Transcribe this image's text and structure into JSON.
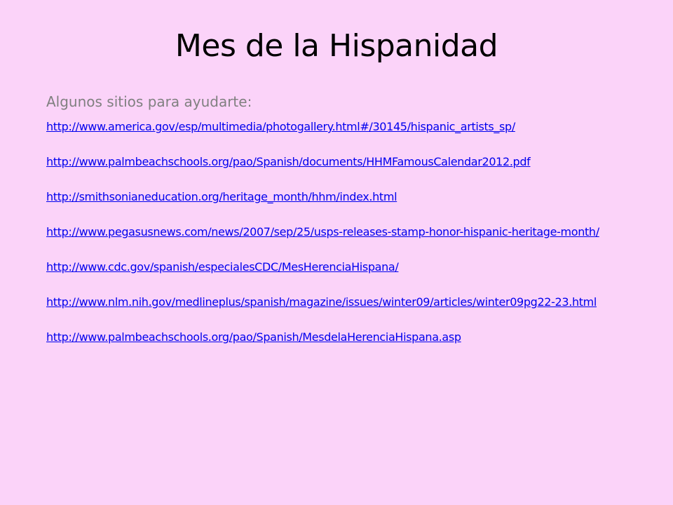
{
  "slide": {
    "title": "Mes de la Hispanidad",
    "subtitle": "Algunos sitios para ayudarte:",
    "links": [
      "http://www.america.gov/esp/multimedia/photogallery.html#/30145/hispanic_artists_sp/",
      "http://www.palmbeachschools.org/pao/Spanish/documents/HHMFamousCalendar2012.pdf",
      "http://smithsonianeducation.org/heritage_month/hhm/index.html",
      "http://www.pegasusnews.com/news/2007/sep/25/usps-releases-stamp-honor-hispanic-heritage-month/",
      "http://www.cdc.gov/spanish/especialesCDC/MesHerenciaHispana/",
      "http://www.nlm.nih.gov/medlineplus/spanish/magazine/issues/winter09/articles/winter09pg22-23.html",
      "http://www.palmbeachschools.org/pao/Spanish/MesdelaHerenciaHispana.asp"
    ]
  },
  "colors": {
    "background": "#fbd3f9",
    "title": "#000000",
    "subtitle": "#808080",
    "link": "#0000ee"
  }
}
